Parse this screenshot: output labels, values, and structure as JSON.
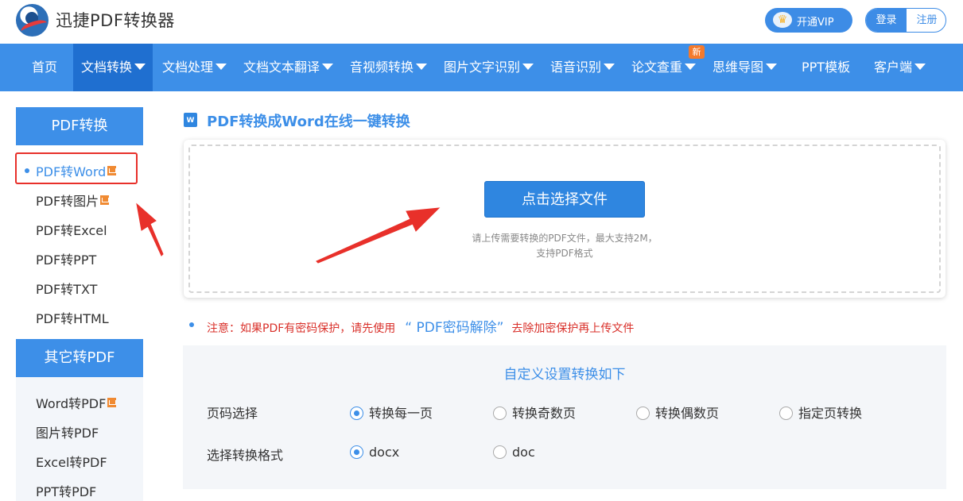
{
  "header": {
    "brand": "迅捷PDF转换器",
    "vip_label": "开通VIP",
    "login_label": "登录",
    "register_label": "注册"
  },
  "nav": {
    "items": [
      {
        "label": "首页",
        "dropdown": false
      },
      {
        "label": "文档转换",
        "dropdown": true,
        "active": true
      },
      {
        "label": "文档处理",
        "dropdown": true
      },
      {
        "label": "文档文本翻译",
        "dropdown": true
      },
      {
        "label": "音视频转换",
        "dropdown": true
      },
      {
        "label": "图片文字识别",
        "dropdown": true
      },
      {
        "label": "语音识别",
        "dropdown": true
      },
      {
        "label": "论文查重",
        "dropdown": true,
        "badge": "新"
      },
      {
        "label": "思维导图",
        "dropdown": true
      },
      {
        "label": "PPT模板",
        "dropdown": false
      },
      {
        "label": "客户端",
        "dropdown": true
      }
    ]
  },
  "sidebar": {
    "group1_title": "PDF转换",
    "group1_items": [
      {
        "label": "PDF转Word",
        "icon": true,
        "active": true
      },
      {
        "label": "PDF转图片",
        "icon": true
      },
      {
        "label": "PDF转Excel"
      },
      {
        "label": "PDF转PPT"
      },
      {
        "label": "PDF转TXT"
      },
      {
        "label": "PDF转HTML"
      }
    ],
    "group2_title": "其它转PDF",
    "group2_items": [
      {
        "label": "Word转PDF",
        "icon": true
      },
      {
        "label": "图片转PDF"
      },
      {
        "label": "Excel转PDF"
      },
      {
        "label": "PPT转PDF"
      }
    ]
  },
  "main": {
    "title": "PDF转换成Word在线一键转换",
    "choose_button": "点击选择文件",
    "hint_line1": "请上传需要转换的PDF文件，最大支持2M，",
    "hint_line2": "支持PDF格式",
    "notice_before": "注意：如果PDF有密码保护，请先使用",
    "notice_link": "“ PDF密码解除”",
    "notice_after": "去除加密保护再上传文件"
  },
  "settings": {
    "title": "自定义设置转换如下",
    "page_label": "页码选择",
    "page_options": [
      {
        "label": "转换每一页",
        "checked": true
      },
      {
        "label": "转换奇数页",
        "checked": false
      },
      {
        "label": "转换偶数页",
        "checked": false
      },
      {
        "label": "指定页转换",
        "checked": false
      }
    ],
    "format_label": "选择转换格式",
    "format_options": [
      {
        "label": "docx",
        "checked": true
      },
      {
        "label": "doc",
        "checked": false
      }
    ]
  },
  "colors": {
    "accent": "#3d8fe8",
    "nav_active": "#1f6fd0",
    "annotation_red": "#e8302a",
    "badge_orange": "#f47a2c"
  }
}
